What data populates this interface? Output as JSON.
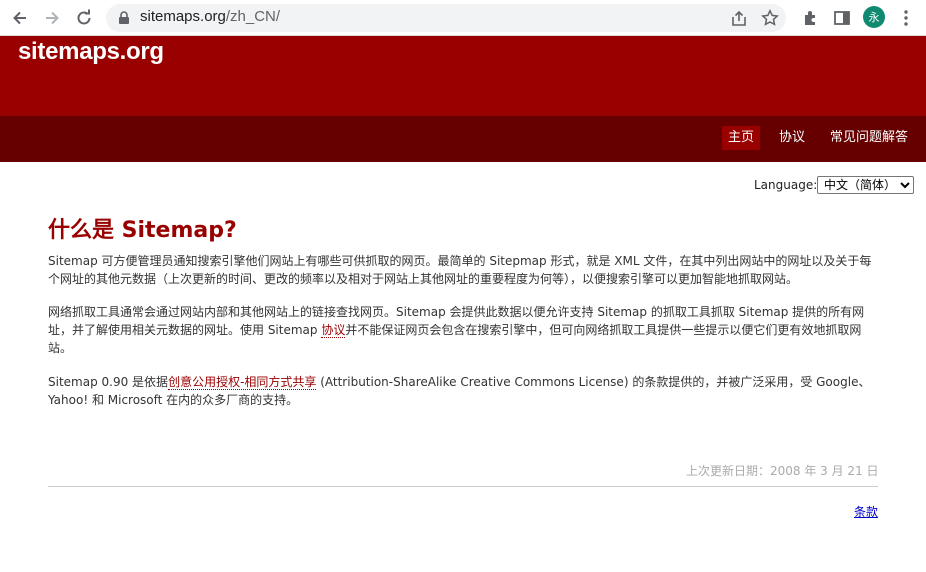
{
  "browser": {
    "url_host": "sitemaps.org",
    "url_path": "/zh_CN/",
    "profile_initial": "永"
  },
  "site": {
    "logo": "sitemaps.org",
    "nav": [
      {
        "label": "主页",
        "active": true
      },
      {
        "label": "协议",
        "active": false
      },
      {
        "label": "常见问题解答",
        "active": false
      }
    ]
  },
  "language": {
    "label": "Language:",
    "selected": "中文（简体）"
  },
  "content": {
    "title": "什么是 Sitemap?",
    "p1": "Sitemap 可方便管理员通知搜索引擎他们网站上有哪些可供抓取的网页。最简单的 Sitepmap 形式，就是 XML 文件，在其中列出网站中的网址以及关于每个网址的其他元数据（上次更新的时间、更改的频率以及相对于网站上其他网址的重要程度为何等），以便搜索引擎可以更加智能地抓取网站。",
    "p2_before": "网络抓取工具通常会通过网站内部和其他网站上的链接查找网页。Sitemap 会提供此数据以便允许支持 Sitemap 的抓取工具抓取 Sitemap 提供的所有网址，并了解使用相关元数据的网址。使用 Sitemap ",
    "p2_link": "协议",
    "p2_after": "并不能保证网页会包含在搜索引擎中，但可向网络抓取工具提供一些提示以便它们更有效地抓取网站。",
    "p3_before": "Sitemap 0.90 是依据",
    "p3_link": "创意公用授权-相同方式共享",
    "p3_after": " (Attribution-ShareAlike Creative Commons License) 的条款提供的，并被广泛采用，受 Google、Yahoo! 和 Microsoft 在内的众多厂商的支持。"
  },
  "footer": {
    "updated": "上次更新日期：2008 年 3 月 21 日",
    "terms": "条款"
  },
  "colors": {
    "header": "#990000",
    "nav_bar": "#660000",
    "title": "#990000",
    "link": "#0000cc"
  }
}
